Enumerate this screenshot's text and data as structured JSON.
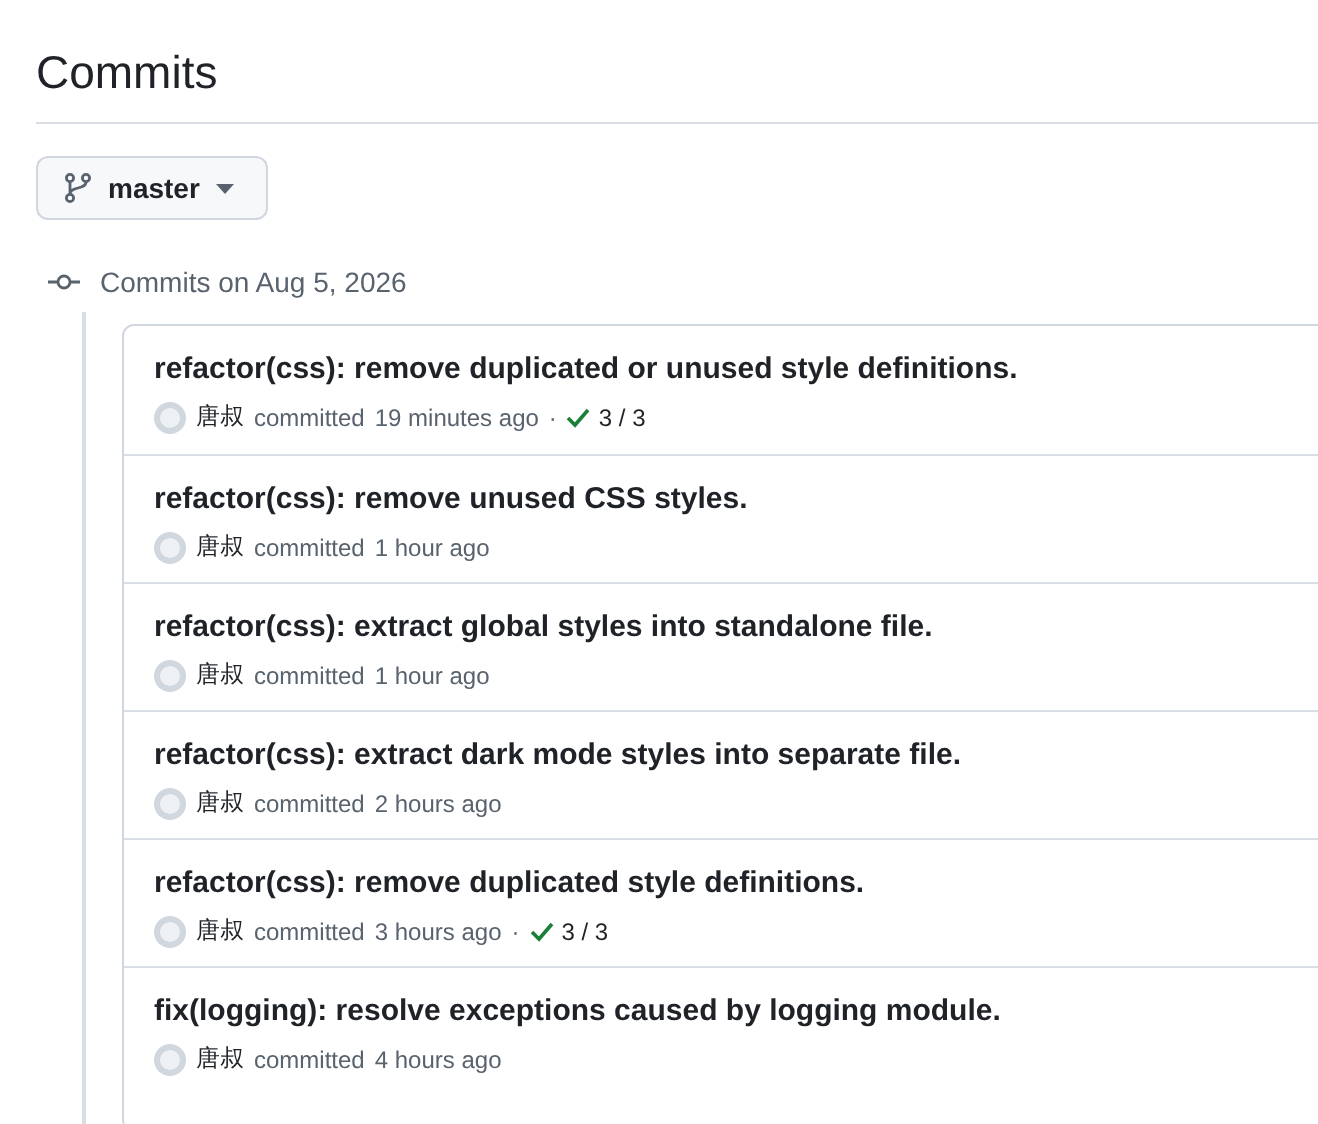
{
  "page": {
    "title": "Commits"
  },
  "branch": {
    "label": "master"
  },
  "group": {
    "heading": "Commits on Aug 5, 2026"
  },
  "commits": [
    {
      "message": "refactor(css): remove duplicated or unused style definitions.",
      "author": "唐叔",
      "action": "committed",
      "time": "19 minutes ago",
      "separator": "·",
      "checks": "3 / 3"
    },
    {
      "message": "refactor(css): remove unused CSS styles.",
      "author": "唐叔",
      "action": "committed",
      "time": "1 hour ago"
    },
    {
      "message": "refactor(css): extract global styles into standalone file.",
      "author": "唐叔",
      "action": "committed",
      "time": "1 hour ago"
    },
    {
      "message": "refactor(css): extract dark mode styles into separate file.",
      "author": "唐叔",
      "action": "committed",
      "time": "2 hours ago"
    },
    {
      "message": "refactor(css): remove duplicated style definitions.",
      "author": "唐叔",
      "action": "committed",
      "time": "3 hours ago",
      "separator": "·",
      "checks": "3 / 3"
    },
    {
      "message": "fix(logging): resolve exceptions caused by logging module.",
      "author": "唐叔",
      "action": "committed",
      "time": "4 hours ago"
    }
  ]
}
